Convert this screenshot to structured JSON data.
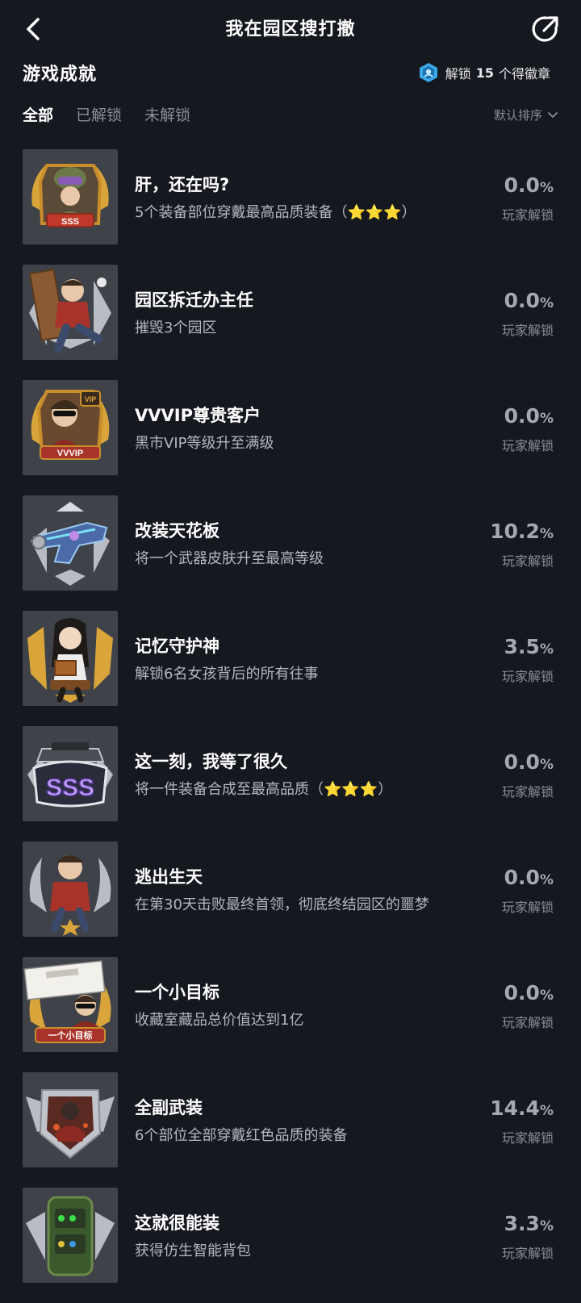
{
  "header": {
    "title": "我在园区搜打撤"
  },
  "section": {
    "title": "游戏成就",
    "badge_prefix": "解锁",
    "badge_count": "15",
    "badge_suffix": "个得徽章"
  },
  "tabs": [
    {
      "label": "全部",
      "active": true
    },
    {
      "label": "已解锁",
      "active": false
    },
    {
      "label": "未解锁",
      "active": false
    }
  ],
  "sort": {
    "label": "默认排序"
  },
  "percent_symbol": "%",
  "achievements": [
    {
      "title": "肝，还在吗?",
      "desc": "5个装备部位穿戴最高品质装备（⭐⭐⭐）",
      "percent": "0.0",
      "percent_label": "玩家解锁",
      "badge_text": "SSS",
      "icon": "soldier-badge-icon"
    },
    {
      "title": "园区拆迁办主任",
      "desc": "摧毁3个园区",
      "percent": "0.0",
      "percent_label": "玩家解锁",
      "badge_text": "",
      "icon": "door-kick-badge-icon"
    },
    {
      "title": "VVVIP尊贵客户",
      "desc": "黑市VIP等级升至满级",
      "percent": "0.0",
      "percent_label": "玩家解锁",
      "badge_text": "VVVIP",
      "icon": "vip-badge-icon"
    },
    {
      "title": "改装天花板",
      "desc": "将一个武器皮肤升至最高等级",
      "percent": "10.2",
      "percent_label": "玩家解锁",
      "badge_text": "",
      "icon": "weapon-skin-badge-icon"
    },
    {
      "title": "记忆守护神",
      "desc": "解锁6名女孩背后的所有往事",
      "percent": "3.5",
      "percent_label": "玩家解锁",
      "badge_text": "",
      "icon": "memory-girl-badge-icon"
    },
    {
      "title": "这一刻，我等了很久",
      "desc": "将一件装备合成至最高品质（⭐⭐⭐）",
      "percent": "0.0",
      "percent_label": "玩家解锁",
      "badge_text": "SSS",
      "icon": "sss-gun-badge-icon"
    },
    {
      "title": "逃出生天",
      "desc": "在第30天击败最终首领，彻底终结园区的噩梦",
      "percent": "0.0",
      "percent_label": "玩家解锁",
      "badge_text": "",
      "icon": "escape-badge-icon"
    },
    {
      "title": "一个小目标",
      "desc": "收藏室藏品总价值达到1亿",
      "percent": "0.0",
      "percent_label": "玩家解锁",
      "badge_text": "一个小目标",
      "icon": "small-goal-badge-icon"
    },
    {
      "title": "全副武装",
      "desc": "6个部位全部穿戴红色品质的装备",
      "percent": "14.4",
      "percent_label": "玩家解锁",
      "badge_text": "",
      "icon": "armor-badge-icon"
    },
    {
      "title": "这就很能装",
      "desc": "获得仿生智能背包",
      "percent": "3.3",
      "percent_label": "玩家解锁",
      "badge_text": "",
      "icon": "backpack-badge-icon"
    }
  ],
  "colors": {
    "background": "#16181f",
    "tile": "#3f4349",
    "gold": "#d9a53a",
    "silver": "#b9bcc2",
    "text_muted": "#8a8d96",
    "badge_icon": "#3aa8e8"
  }
}
